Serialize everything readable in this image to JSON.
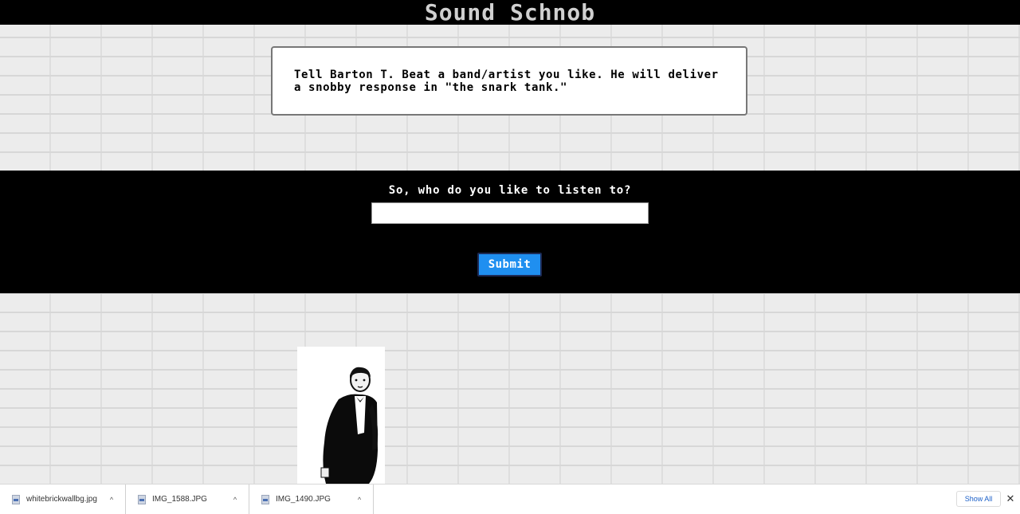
{
  "header": {
    "title": "Sound Schnob"
  },
  "intro": {
    "text": "Tell Barton T. Beat a band/artist you like. He will deliver a snobby response in \"the snark tank.\""
  },
  "form": {
    "question": "So, who do you like to listen to?",
    "input_value": "",
    "submit_label": "Submit"
  },
  "downloads": {
    "items": [
      {
        "name": "whitebrickwallbg.jpg"
      },
      {
        "name": "IMG_1588.JPG"
      },
      {
        "name": "IMG_1490.JPG"
      }
    ],
    "show_all_label": "Show All",
    "close_symbol": "✕"
  },
  "colors": {
    "header_bg": "#000000",
    "form_band_bg": "#000000",
    "submit_bg": "#1f8ff0",
    "show_all_text": "#1a5fc8"
  }
}
